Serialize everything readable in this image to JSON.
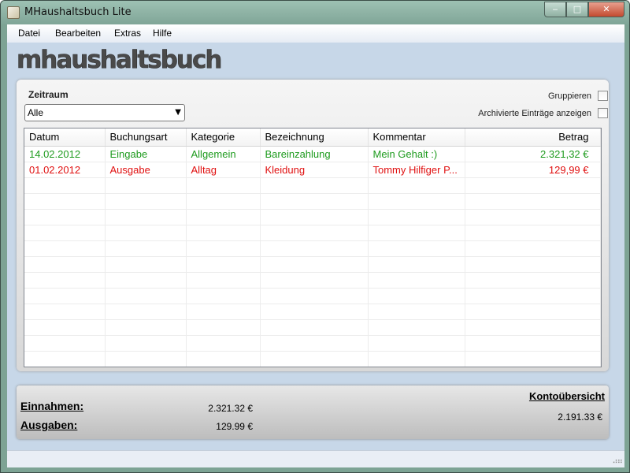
{
  "window": {
    "title": "MHaushaltsbuch Lite",
    "controls": {
      "minimize": "‒",
      "maximize": "□",
      "close": "✕"
    }
  },
  "menu": [
    "Datei",
    "Bearbeiten",
    "Extras",
    "Hilfe"
  ],
  "logo_text": "mhaushaltsbuch",
  "filter": {
    "zeitraum_label": "Zeitraum",
    "zeitraum_value": "Alle",
    "gruppieren_label": "Gruppieren",
    "archiv_label": "Archivierte Einträge anzeigen"
  },
  "table": {
    "columns": [
      "Datum",
      "Buchungsart",
      "Kategorie",
      "Bezeichnung",
      "Kommentar",
      "Betrag"
    ],
    "rows": [
      {
        "cells": [
          "14.02.2012",
          "Eingabe",
          "Allgemein",
          "Bareinzahlung",
          "Mein Gehalt :)",
          "2.321,32 €"
        ],
        "color": "#1e9b1e"
      },
      {
        "cells": [
          "01.02.2012",
          "Ausgabe",
          "Alltag",
          "Kleidung",
          "Tommy Hilfiger P...",
          "129,99 €"
        ],
        "color": "#e01010"
      }
    ]
  },
  "summary": {
    "einnahmen_label": "Einnahmen:",
    "einnahmen_value": "2.321.32 €",
    "ausgaben_label": "Ausgaben:",
    "ausgaben_value": "129.99 €",
    "konto_label": "Kontoübersicht",
    "konto_value": "2.191.33 €"
  },
  "colors": {
    "income": "#1e9b1e",
    "expense": "#e01010",
    "frame": "#7da394",
    "client": "#c7d7e8"
  }
}
